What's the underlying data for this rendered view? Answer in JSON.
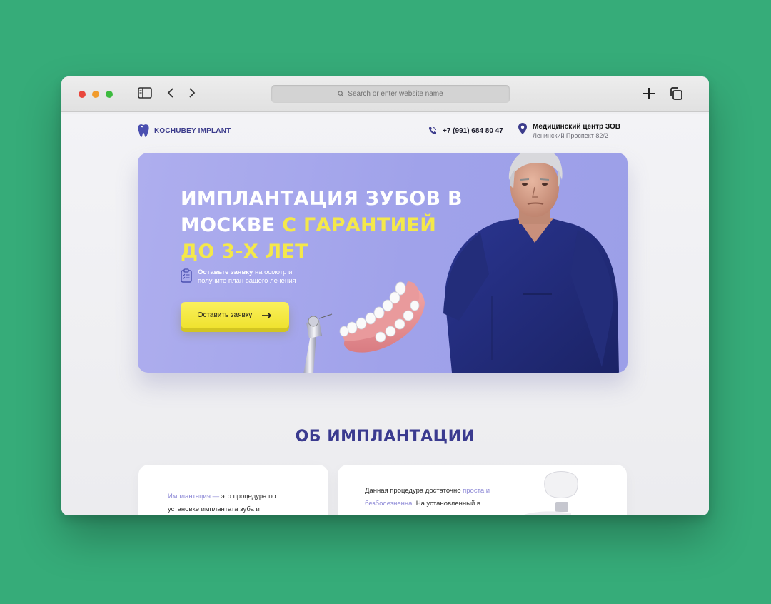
{
  "browser": {
    "url_placeholder": "Search or enter website name",
    "icons": [
      "sidebar-icon",
      "back-icon",
      "forward-icon",
      "search-icon",
      "new-tab-icon",
      "tabs-overview-icon"
    ]
  },
  "header": {
    "logo_text": "KOCHUBEY IMPLANT",
    "phone": "+7 (991) 684 80 47",
    "clinic_name": "Медицинский центр ЗОВ",
    "clinic_address": "Ленинский Проспект 82/2"
  },
  "hero": {
    "title_white": "ИМПЛАНТАЦИЯ ЗУБОВ В МОСКВЕ ",
    "title_yellow": "С ГАРАНТИЕЙ ДО 3-Х ЛЕТ",
    "note_bold": "Оставьте заявку",
    "note_rest": " на осмотр и получите план вашего лечения",
    "cta_label": "Оставить заявку"
  },
  "about": {
    "title": "ОБ ИМПЛАНТАЦИИ",
    "card1_accent": "Имплантация —",
    "card1_text": " это процедура по установке имплантата зуба и",
    "card2_text_a": "Данная процедура достаточно ",
    "card2_accent": "проста и безболезненна",
    "card2_text_b": ". На установленный в"
  },
  "colors": {
    "background": "#36ac79",
    "hero": "#a4a6ec",
    "accent_yellow": "#f4e84a",
    "brand_indigo": "#3b3b8f",
    "cta": "#f4e63e"
  }
}
